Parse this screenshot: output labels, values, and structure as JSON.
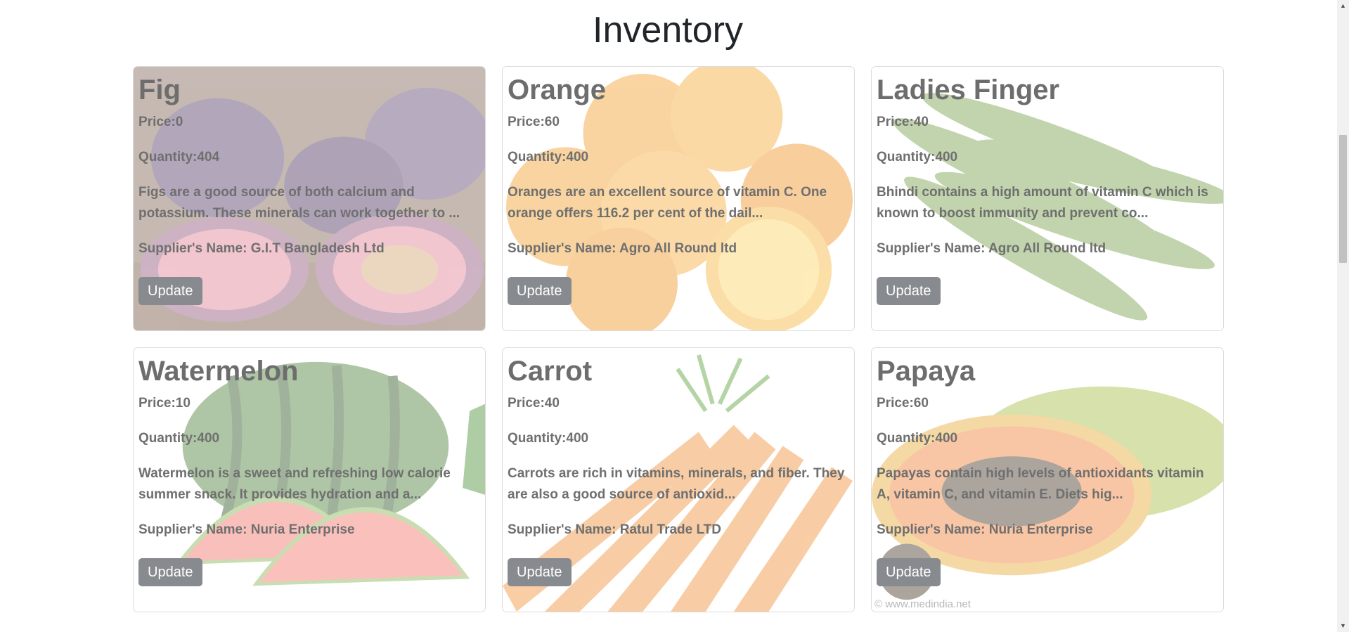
{
  "page": {
    "title": "Inventory"
  },
  "items": [
    {
      "name": "Fig",
      "price": "Price:0",
      "quantity": "Quantity:404",
      "description": "Figs are a good source of both calcium and potassium. These minerals can work together to ...",
      "supplier": "Supplier's Name: G.I.T Bangladesh Ltd",
      "button": "Update",
      "image": "fig-image"
    },
    {
      "name": "Orange",
      "price": "Price:60",
      "quantity": "Quantity:400",
      "description": "Oranges are an excellent source of vitamin C. One orange offers 116.2 per cent of the dail...",
      "supplier": "Supplier's Name: Agro All Round ltd",
      "button": "Update",
      "image": "orange-image"
    },
    {
      "name": "Ladies Finger",
      "price": "Price:40",
      "quantity": "Quantity:400",
      "description": "Bhindi contains a high amount of vitamin C which is known to boost immunity and prevent co...",
      "supplier": "Supplier's Name: Agro All Round ltd",
      "button": "Update",
      "image": "okra-image"
    },
    {
      "name": "Watermelon",
      "price": "Price:10",
      "quantity": "Quantity:400",
      "description": "Watermelon is a sweet and refreshing low calorie summer snack. It provides hydration and a...",
      "supplier": "Supplier's Name: Nuria Enterprise",
      "button": "Update",
      "image": "watermelon-image"
    },
    {
      "name": "Carrot",
      "price": "Price:40",
      "quantity": "Quantity:400",
      "description": "Carrots are rich in vitamins, minerals, and fiber. They are also a good source of antioxid...",
      "supplier": "Supplier's Name: Ratul Trade LTD",
      "button": "Update",
      "image": "carrot-image"
    },
    {
      "name": "Papaya",
      "price": "Price:60",
      "quantity": "Quantity:400",
      "description": "Papayas contain high levels of antioxidants vitamin A, vitamin C, and vitamin E. Diets hig...",
      "supplier": "Supplier's Name: Nuria Enterprise",
      "button": "Update",
      "image": "papaya-image",
      "watermark": "© www.medindia.net"
    }
  ],
  "colors": {
    "button": "#878b8f",
    "text_muted": "#6f6f6f"
  }
}
